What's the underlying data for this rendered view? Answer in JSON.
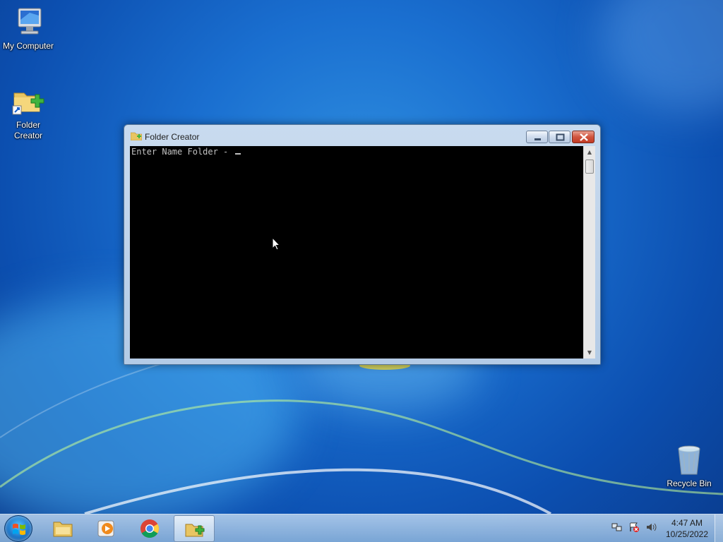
{
  "desktop": {
    "icons": [
      {
        "label": "My Computer",
        "icon": "computer-icon"
      },
      {
        "label": "Folder\nCreator",
        "icon": "folder-shortcut-icon"
      },
      {
        "label": "Recycle Bin",
        "icon": "recycle-bin-icon"
      }
    ]
  },
  "window": {
    "title": "Folder Creator",
    "icon": "folder-add-icon",
    "buttons": {
      "minimize": "minimize-icon",
      "maximize": "maximize-icon",
      "close": "close-icon"
    },
    "console": {
      "prompt": "Enter Name Folder - "
    }
  },
  "taskbar": {
    "start_icon": "windows-start-icon",
    "pinned": [
      "file-explorer-icon",
      "media-player-icon",
      "chrome-icon",
      "folder-creator-icon"
    ],
    "tray_icons": [
      "network-icon",
      "action-center-icon",
      "volume-icon"
    ],
    "clock": {
      "time": "4:47 AM",
      "date": "10/25/2022"
    }
  },
  "colors": {
    "console_bg": "#000000",
    "console_text": "#c0c0c0",
    "close_button": "#c8432c"
  }
}
